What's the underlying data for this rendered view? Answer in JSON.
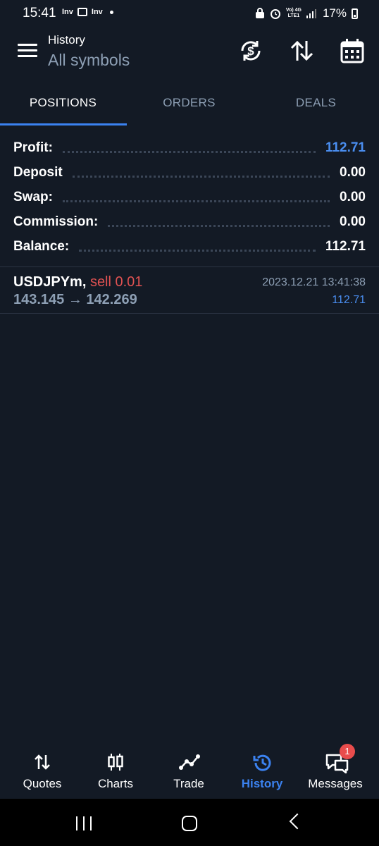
{
  "status_bar": {
    "time": "15:41",
    "notif_app_1": "Inv",
    "notif_app_2": "Inv",
    "network_top": "Vo) 4G",
    "network_bottom": "LTE1",
    "battery": "17%"
  },
  "header": {
    "subtitle": "History",
    "title": "All symbols",
    "icons": [
      "currency-exchange-icon",
      "sort-icon",
      "calendar-icon"
    ]
  },
  "tabs": [
    {
      "label": "POSITIONS",
      "active": true
    },
    {
      "label": "ORDERS",
      "active": false
    },
    {
      "label": "DEALS",
      "active": false
    }
  ],
  "summary": [
    {
      "label": "Profit:",
      "value": "112.71"
    },
    {
      "label": "Deposit",
      "value": "0.00"
    },
    {
      "label": "Swap:",
      "value": "0.00"
    },
    {
      "label": "Commission:",
      "value": "0.00"
    },
    {
      "label": "Balance:",
      "value": "112.71"
    }
  ],
  "positions": [
    {
      "symbol": "USDJPYm,",
      "side": "sell 0.01",
      "prices": "143.145 → 142.269",
      "time": "2023.12.21 13:41:38",
      "profit": "112.71"
    }
  ],
  "bottom_nav": [
    {
      "label": "Quotes",
      "icon": "quotes-icon"
    },
    {
      "label": "Charts",
      "icon": "candlestick-icon"
    },
    {
      "label": "Trade",
      "icon": "trade-line-icon"
    },
    {
      "label": "History",
      "icon": "history-icon",
      "active": true
    },
    {
      "label": "Messages",
      "icon": "chat-icon",
      "badge": "1"
    }
  ],
  "colors": {
    "background": "#131a25",
    "accent": "#3b82f0",
    "sell": "#e05252",
    "muted": "#8d9fb4"
  }
}
